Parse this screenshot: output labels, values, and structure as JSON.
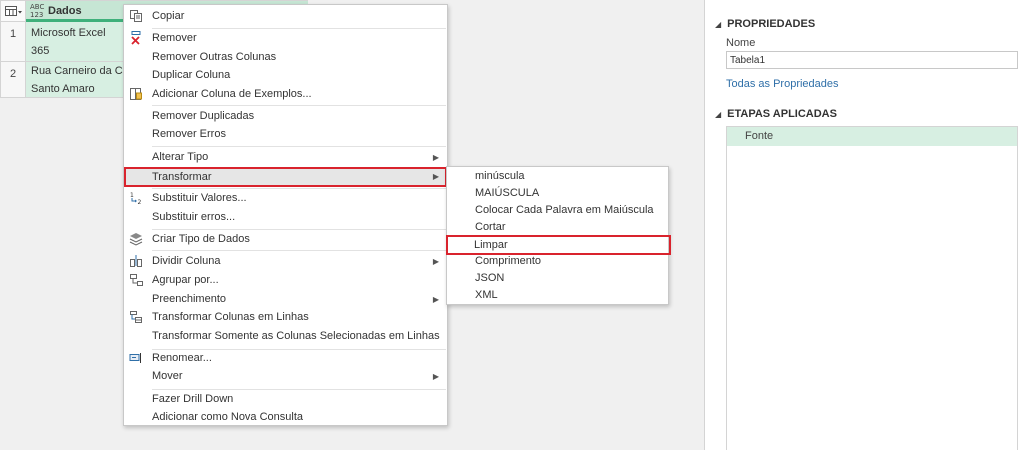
{
  "grid": {
    "column_type": "ABC\n123",
    "column_name": "Dados",
    "rows": [
      {
        "num": "1",
        "lines": [
          "Microsoft Excel",
          "365"
        ]
      },
      {
        "num": "2",
        "lines": [
          "Rua Carneiro da Cunh",
          "Santo Amaro"
        ]
      }
    ]
  },
  "panel": {
    "properties_title": "PROPRIEDADES",
    "name_label": "Nome",
    "name_value": "Tabela1",
    "all_properties_link": "Todas as Propriedades",
    "applied_steps_title": "ETAPAS APLICADAS",
    "steps": [
      "Fonte"
    ]
  },
  "context_menu": {
    "items": [
      {
        "label": "Copiar",
        "icon": "copy-icon"
      },
      {
        "label": "Remover",
        "icon": "remove-column-icon"
      },
      {
        "label": "Remover Outras Colunas"
      },
      {
        "label": "Duplicar Coluna"
      },
      {
        "label": "Adicionar Coluna de Exemplos...",
        "icon": "column-from-examples-icon"
      },
      {
        "label": "Remover Duplicadas"
      },
      {
        "label": "Remover Erros"
      },
      {
        "label": "Alterar Tipo"
      },
      {
        "label": "Transformar"
      },
      {
        "label": "Substituir Valores...",
        "icon": "replace-values-icon"
      },
      {
        "label": "Substituir erros..."
      },
      {
        "label": "Criar Tipo de Dados",
        "icon": "data-type-icon"
      },
      {
        "label": "Dividir Coluna",
        "icon": "split-column-icon"
      },
      {
        "label": "Agrupar por...",
        "icon": "group-by-icon"
      },
      {
        "label": "Preenchimento"
      },
      {
        "label": "Transformar Colunas em Linhas",
        "icon": "unpivot-icon"
      },
      {
        "label": "Transformar Somente as Colunas Selecionadas em Linhas"
      },
      {
        "label": "Renomear...",
        "icon": "rename-icon"
      },
      {
        "label": "Mover"
      },
      {
        "label": "Fazer Drill Down"
      },
      {
        "label": "Adicionar como Nova Consulta"
      }
    ]
  },
  "submenu": {
    "items": [
      "minúscula",
      "MAIÚSCULA",
      "Colocar Cada Palavra em Maiúscula",
      "Cortar",
      "Limpar",
      "Comprimento",
      "JSON",
      "XML"
    ]
  },
  "colors": {
    "highlight_outline": "#d9232d",
    "selected_cell": "#d7efe2",
    "column_header": "#c6e6d4",
    "link": "#2f6fa8"
  }
}
